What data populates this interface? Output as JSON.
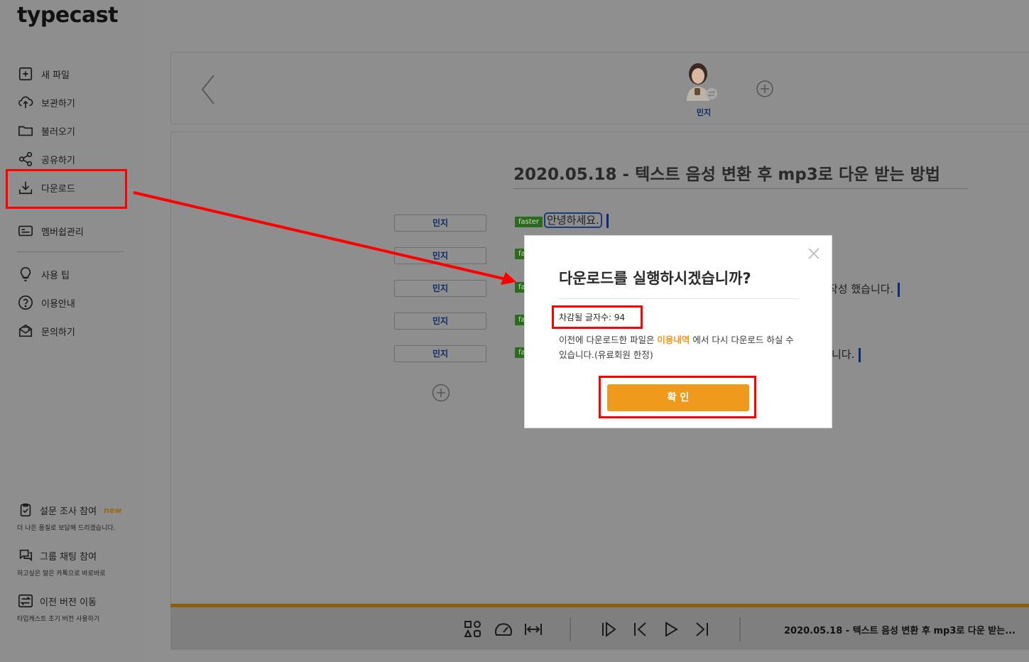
{
  "app": {
    "logo_text": "typecast"
  },
  "sidebar": {
    "items": [
      {
        "label": "새 파일",
        "icon": "file-plus-icon"
      },
      {
        "label": "보관하기",
        "icon": "cloud-upload-icon"
      },
      {
        "label": "불러오기",
        "icon": "folder-icon"
      },
      {
        "label": "공유하기",
        "icon": "share-icon"
      },
      {
        "label": "다운로드",
        "icon": "download-icon"
      },
      {
        "label": "멤버쉽관리",
        "icon": "membership-card-icon"
      },
      {
        "label": "사용 팁",
        "icon": "lightbulb-icon"
      },
      {
        "label": "이용안내",
        "icon": "help-circle-icon"
      },
      {
        "label": "문의하기",
        "icon": "inquiry-mail-icon"
      }
    ],
    "bottom": [
      {
        "label": "설문 조사 참여",
        "badge": "new",
        "sub": "더 나은 품질로 보답해 드리겠습니다.",
        "icon": "survey-clipboard-icon"
      },
      {
        "label": "그룹 채팅 참여",
        "sub": "하고싶은 말은 카톡으로 바로바로",
        "icon": "chat-bubbles-icon"
      },
      {
        "label": "이전 버전 이동",
        "sub": "타입캐스트 초기 버전 사용하기",
        "icon": "switch-version-icon"
      }
    ]
  },
  "voice_bar": {
    "active_voice": "민지"
  },
  "editor": {
    "title": "2020.05.18 - 텍스트 음성 변환 후 mp3로 다운 받는 방법",
    "rows": [
      {
        "speaker": "민지",
        "speed": "faster",
        "text": "안녕하세요."
      },
      {
        "speaker": "민지",
        "speed": "fa",
        "text": ""
      },
      {
        "speaker": "민지",
        "speed": "fa",
        "text": "작성 했습니다."
      },
      {
        "speaker": "민지",
        "speed": "fa",
        "text": ""
      },
      {
        "speaker": "민지",
        "speed": "fa",
        "text": "니다."
      }
    ]
  },
  "player": {
    "title": "2020.05.18 - 텍스트 음성 변환 후 mp3로 다운 받는..."
  },
  "dialog": {
    "title": "다운로드를 실행하시겠습니까?",
    "deduct_text": "차감될 글자수: 94",
    "desc_pre": "이전에 다운로드한 파일은 ",
    "desc_link": "이용내역",
    "desc_post": " 에서 다시 다운로드 하실 수 있습니다.(유료회원 한정)",
    "confirm_label": "확 인"
  },
  "colors": {
    "accent_orange": "#f09a1d",
    "annotation_red": "#ff0000",
    "speaker_blue": "#0f2d6b"
  }
}
